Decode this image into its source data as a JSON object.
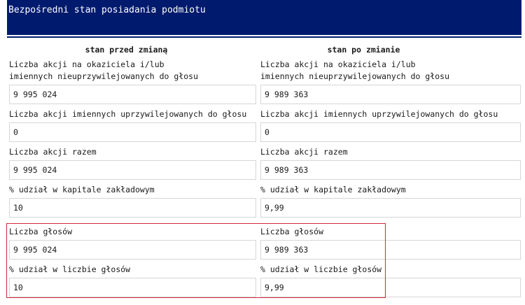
{
  "header": {
    "title": "Bezpośredni stan posiadania podmiotu"
  },
  "columns": {
    "before": "stan przed zmianą",
    "after": "stan po zmianie"
  },
  "fields": [
    {
      "label": "Liczba akcji na okaziciela i/lub imiennych nieuprzywilejowanych do głosu",
      "before": "9 995 024",
      "after": "9 989 363"
    },
    {
      "label": "Liczba akcji imiennych uprzywilejowanych do głosu",
      "before": "0",
      "after": "0"
    },
    {
      "label": "Liczba akcji razem",
      "before": "9 995 024",
      "after": "9 989 363"
    },
    {
      "label": "% udział w kapitale zakładowym",
      "before": "10",
      "after": "9,99"
    },
    {
      "label": "Liczba głosów",
      "before": "9 995 024",
      "after": "9 989 363"
    },
    {
      "label": "% udział w liczbie głosów",
      "before": "10",
      "after": "9,99"
    }
  ],
  "colors": {
    "header_bg": "#001a6e",
    "highlight_border": "#d22a3a"
  }
}
